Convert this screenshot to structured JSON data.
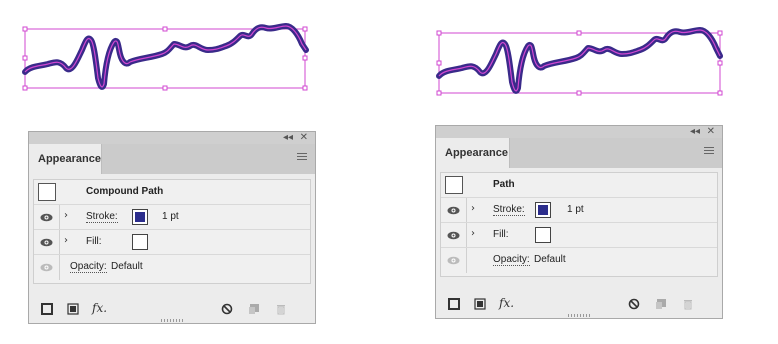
{
  "colors": {
    "selection": "#d147d1",
    "stroke": "#3a2a8a",
    "stroke_swatch": "#2c2d8c",
    "panel_bg": "#ececec"
  },
  "panels": [
    {
      "tab_label": "Appearance",
      "object_title": "Compound Path",
      "stroke_label": "Stroke:",
      "stroke_value": "1 pt",
      "fill_label": "Fill:",
      "opacity_label": "Opacity:",
      "opacity_value": "Default",
      "collapse_glyph": "◂◂",
      "close_glyph": "✕",
      "fx_label": "fx."
    },
    {
      "tab_label": "Appearance",
      "object_title": "Path",
      "stroke_label": "Stroke:",
      "stroke_value": "1 pt",
      "fill_label": "Fill:",
      "opacity_label": "Opacity:",
      "opacity_value": "Default",
      "collapse_glyph": "◂◂",
      "close_glyph": "✕",
      "fx_label": "fx."
    }
  ],
  "icons": {
    "eye": "eye-icon",
    "chevron": "chevron-right-icon",
    "new_stroke": "add-new-stroke-icon",
    "new_fill": "add-new-fill-icon",
    "fx": "add-effect-icon",
    "clear": "clear-appearance-icon",
    "duplicate": "duplicate-item-icon",
    "delete": "trash-icon",
    "menu": "panel-menu-icon"
  }
}
